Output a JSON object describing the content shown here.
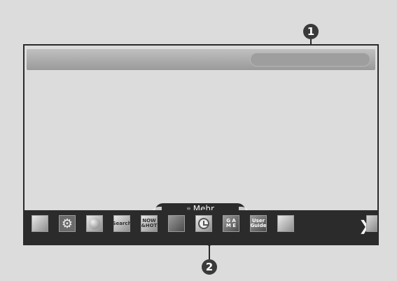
{
  "callouts": {
    "first": "1",
    "second": "2"
  },
  "launcher": {
    "more_label": "Mehr",
    "apps": [
      {
        "name": "premium-icon",
        "label": ""
      },
      {
        "name": "settings-icon",
        "label": ""
      },
      {
        "name": "internet-icon",
        "label": ""
      },
      {
        "name": "search-icon",
        "label": "Search"
      },
      {
        "name": "now-hot-icon",
        "label": "NOW &HOT"
      },
      {
        "name": "smart-share-icon",
        "label": ""
      },
      {
        "name": "scheduler-icon",
        "label": ""
      },
      {
        "name": "game-icon",
        "label": "G A M E"
      },
      {
        "name": "user-guide-icon",
        "label": "User Guide"
      },
      {
        "name": "input-list-icon",
        "label": ""
      }
    ],
    "next_arrow": "❯"
  }
}
